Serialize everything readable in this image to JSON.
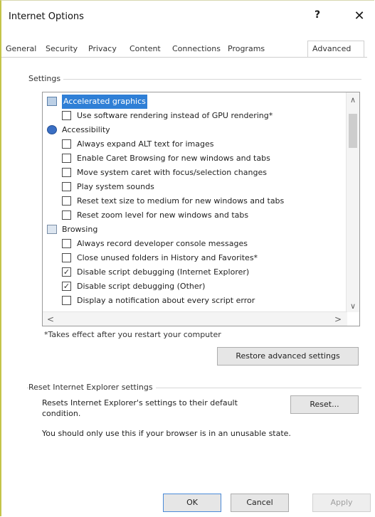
{
  "window": {
    "title": "Internet Options",
    "help": "?",
    "close": "✕"
  },
  "tabs": [
    "General",
    "Security",
    "Privacy",
    "Content",
    "Connections",
    "Programs",
    "Advanced"
  ],
  "settings_group": "Settings",
  "settings_items": [
    {
      "kind": "category",
      "icon": "monitor-icon",
      "label": "Accelerated graphics",
      "selected": true
    },
    {
      "kind": "checkbox",
      "label": "Use software rendering instead of GPU rendering*",
      "checked": false
    },
    {
      "kind": "category",
      "icon": "globe-icon",
      "label": "Accessibility"
    },
    {
      "kind": "checkbox",
      "label": "Always expand ALT text for images",
      "checked": false
    },
    {
      "kind": "checkbox",
      "label": "Enable Caret Browsing for new windows and tabs",
      "checked": false
    },
    {
      "kind": "checkbox",
      "label": "Move system caret with focus/selection changes",
      "checked": false
    },
    {
      "kind": "checkbox",
      "label": "Play system sounds",
      "checked": false
    },
    {
      "kind": "checkbox",
      "label": "Reset text size to medium for new windows and tabs",
      "checked": false
    },
    {
      "kind": "checkbox",
      "label": "Reset zoom level for new windows and tabs",
      "checked": false
    },
    {
      "kind": "category",
      "icon": "folder-icon",
      "label": "Browsing"
    },
    {
      "kind": "checkbox",
      "label": "Always record developer console messages",
      "checked": false
    },
    {
      "kind": "checkbox",
      "label": "Close unused folders in History and Favorites*",
      "checked": false
    },
    {
      "kind": "checkbox",
      "label": "Disable script debugging (Internet Explorer)",
      "checked": true
    },
    {
      "kind": "checkbox",
      "label": "Disable script debugging (Other)",
      "checked": true
    },
    {
      "kind": "checkbox",
      "label": "Display a notification about every script error",
      "checked": false
    }
  ],
  "restart_note": "*Takes effect after you restart your computer",
  "restore_button": "Restore advanced settings",
  "reset_group": "Reset Internet Explorer settings",
  "reset_description": "Resets Internet Explorer's settings to their default condition.",
  "reset_button": "Reset...",
  "warning_text": "You should only use this if your browser is in an unusable state.",
  "footer": {
    "ok": "OK",
    "cancel": "Cancel",
    "apply": "Apply"
  }
}
